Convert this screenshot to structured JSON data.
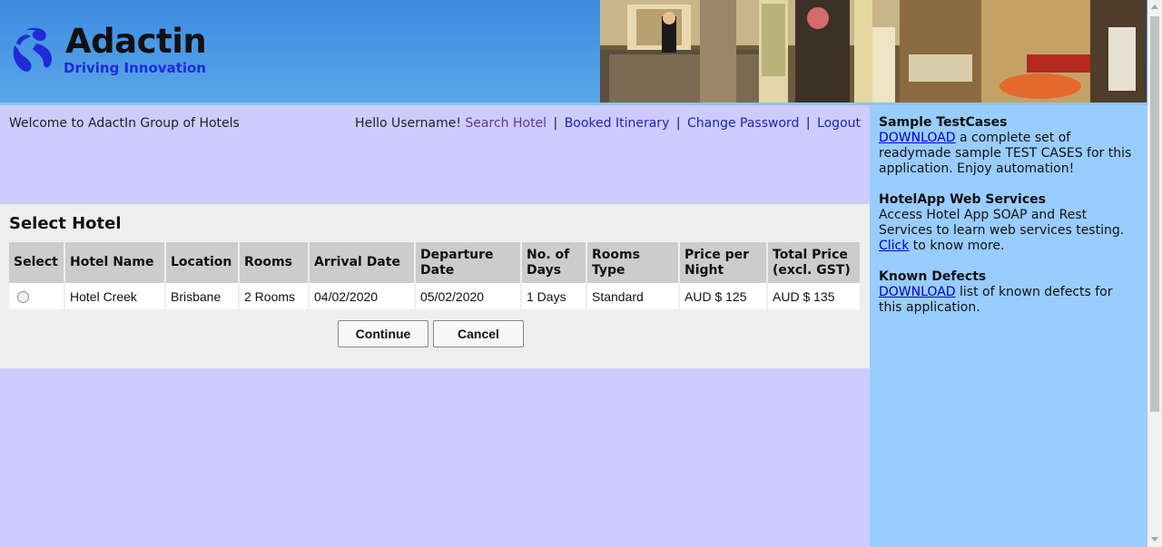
{
  "brand": {
    "name": "Adactin",
    "tagline": "Driving Innovation",
    "header_image": "hotel-lobby-image"
  },
  "colors": {
    "header_blue": "#3d8be0",
    "main_background": "#ccccff",
    "panel_background": "#eeeeee",
    "sidebar_background": "#99ccff",
    "link": "#2222bb",
    "visited_link": "#663399"
  },
  "welcome_text": "Welcome to AdactIn Group of Hotels",
  "topnav": {
    "greeting": "Hello Username!",
    "search_hotel": "Search Hotel",
    "booked_itinerary": "Booked Itinerary",
    "change_password": "Change Password",
    "logout": "Logout",
    "separator": "|"
  },
  "select_hotel": {
    "title": "Select Hotel",
    "columns": [
      "Select",
      "Hotel Name",
      "Location",
      "Rooms",
      "Arrival Date",
      "Departure Date",
      "No. of Days",
      "Rooms Type",
      "Price per Night",
      "Total Price (excl. GST)"
    ],
    "rows": [
      {
        "selected": false,
        "hotel_name": "Hotel Creek",
        "location": "Brisbane",
        "rooms": "2 Rooms",
        "arrival_date": "04/02/2020",
        "departure_date": "05/02/2020",
        "days": "1 Days",
        "room_type": "Standard",
        "price_per_night": "AUD $ 125",
        "total_price": "AUD $ 135"
      }
    ],
    "continue_label": "Continue",
    "cancel_label": "Cancel"
  },
  "sidebar": {
    "testcases": {
      "title": "Sample TestCases",
      "link": "DOWNLOAD",
      "text": " a complete set of readymade sample TEST CASES for this application. Enjoy automation!"
    },
    "webservices": {
      "title": "HotelApp Web Services",
      "text": "Access Hotel App SOAP and Rest Services to learn web services testing. ",
      "link": "Click",
      "text_after": " to know more."
    },
    "defects": {
      "title": "Known Defects",
      "link": "DOWNLOAD",
      "text": " list of known defects for this application."
    }
  }
}
